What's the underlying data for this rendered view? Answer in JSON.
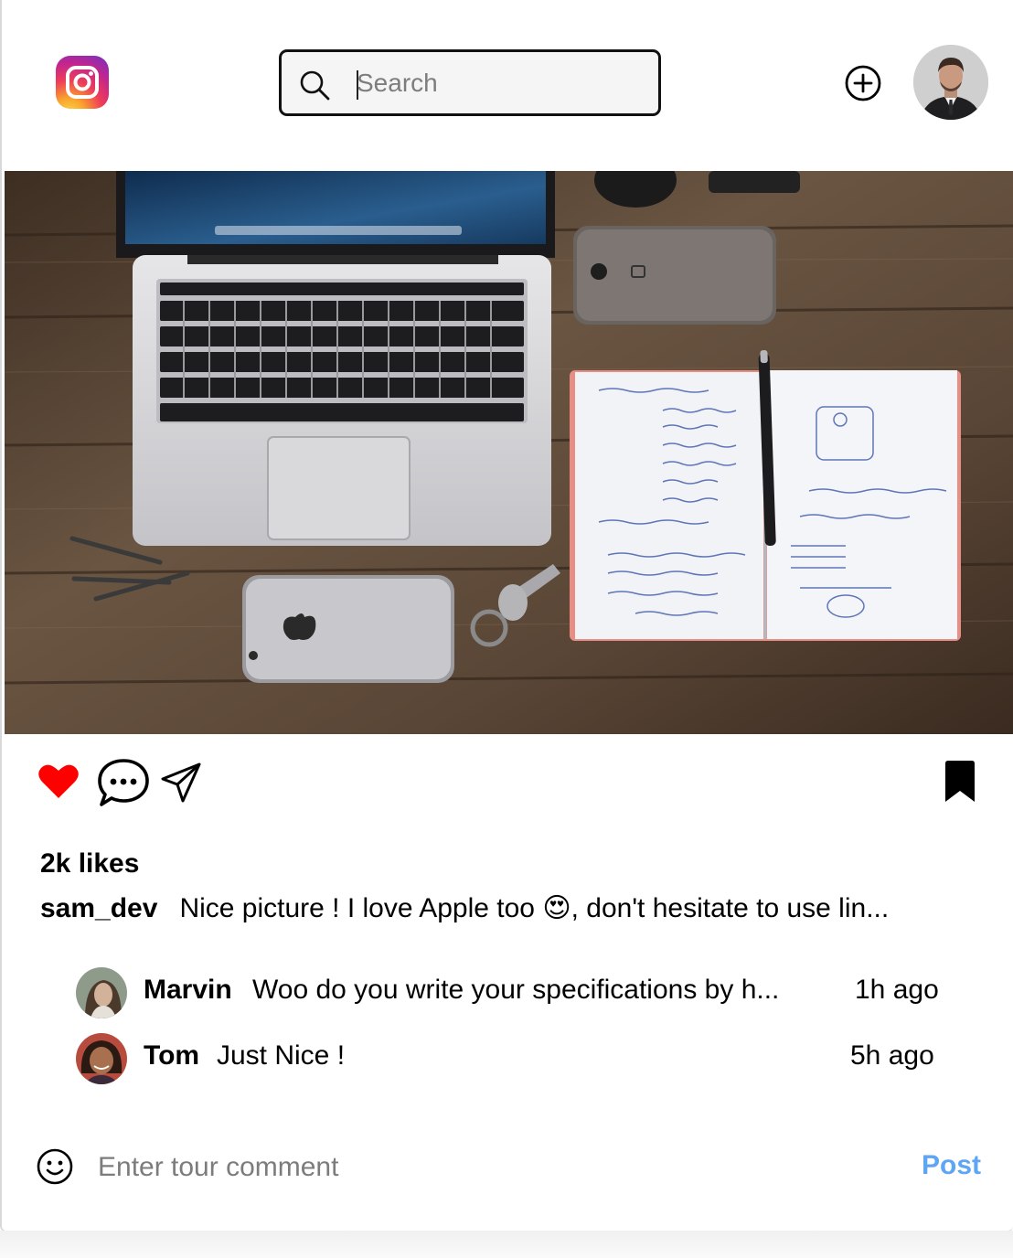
{
  "header": {
    "logo_icon": "instagram-logo-icon",
    "search": {
      "placeholder": "Search",
      "value": "",
      "icon": "search-icon"
    },
    "add_icon": "plus-circle-icon",
    "avatar_icon": "user-avatar"
  },
  "post": {
    "image_description_icon": "photo",
    "actions": {
      "like_icon": "heart-filled-icon",
      "like_color": "#ff0000",
      "comment_icon": "chat-bubble-icon",
      "share_icon": "paper-plane-icon",
      "save_icon": "bookmark-filled-icon"
    },
    "likes": "2k likes",
    "caption": {
      "user": "sam_dev",
      "text": "Nice picture ! I love Apple too 😍, don't hesitate to use lin..."
    },
    "comments": [
      {
        "user": "Marvin",
        "text": "Woo do you write your specifications by h...",
        "time": "1h ago"
      },
      {
        "user": "Tom",
        "text": "Just Nice !",
        "time": "5h ago"
      }
    ],
    "comment_box": {
      "emoji_icon": "smiley-icon",
      "placeholder": "Enter tour comment",
      "post_label": "Post",
      "post_color": "#5ea6f3"
    }
  }
}
